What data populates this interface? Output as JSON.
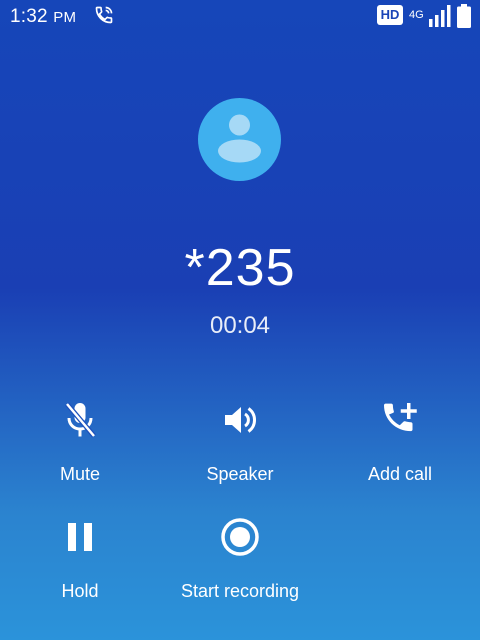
{
  "status_bar": {
    "time": "1:32",
    "ampm": "PM",
    "hd_badge": "HD",
    "network_type": "4G",
    "icons": {
      "call": "phone-call-icon",
      "signal": "signal-bars-icon",
      "battery": "battery-icon"
    }
  },
  "call": {
    "avatar_icon": "person-avatar-icon",
    "number": "*235",
    "timer": "00:04"
  },
  "actions": [
    {
      "label": "Mute",
      "icon": "mic-off-icon"
    },
    {
      "label": "Speaker",
      "icon": "speaker-icon"
    },
    {
      "label": "Add call",
      "icon": "add-call-icon"
    },
    {
      "label": "Hold",
      "icon": "pause-icon"
    },
    {
      "label": "Start recording",
      "icon": "record-icon"
    }
  ],
  "colors": {
    "background_top": "#1646b9",
    "background_bottom": "#2b93da",
    "avatar": "#3fb0ee",
    "foreground": "#ffffff"
  }
}
